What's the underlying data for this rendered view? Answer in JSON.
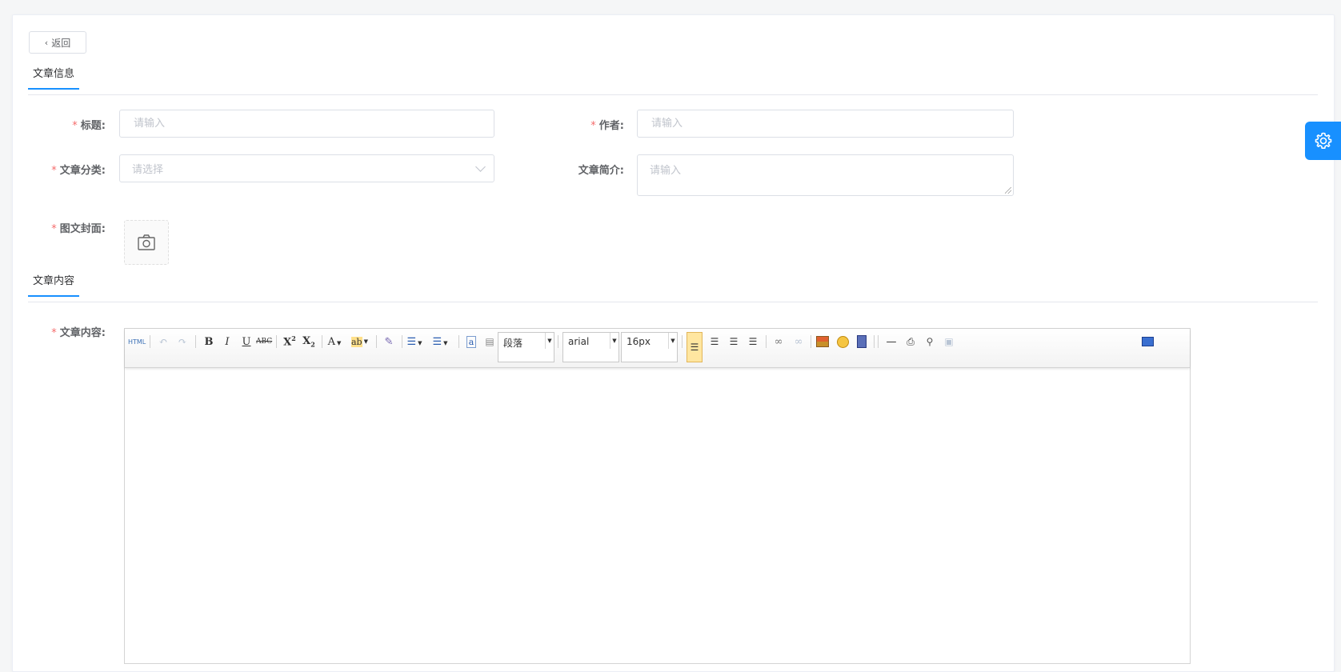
{
  "back_button": {
    "label": "返回"
  },
  "section_info": {
    "title": "文章信息"
  },
  "section_content": {
    "title": "文章内容"
  },
  "form": {
    "title": {
      "label": "标题:",
      "placeholder": "请输入"
    },
    "author": {
      "label": "作者:",
      "placeholder": "请输入"
    },
    "category": {
      "label": "文章分类:",
      "placeholder": "请选择"
    },
    "summary": {
      "label": "文章简介:",
      "placeholder": "请输入"
    },
    "cover": {
      "label": "图文封面:"
    },
    "content": {
      "label": "文章内容:"
    }
  },
  "editor": {
    "html_label": "HTML",
    "bold": "B",
    "italic": "I",
    "underline": "U",
    "strike": "ABC",
    "paragraph_select": "段落",
    "font_select": "arial",
    "size_select": "16px"
  },
  "colors": {
    "accent": "#1890ff",
    "required": "#f56c6c"
  }
}
